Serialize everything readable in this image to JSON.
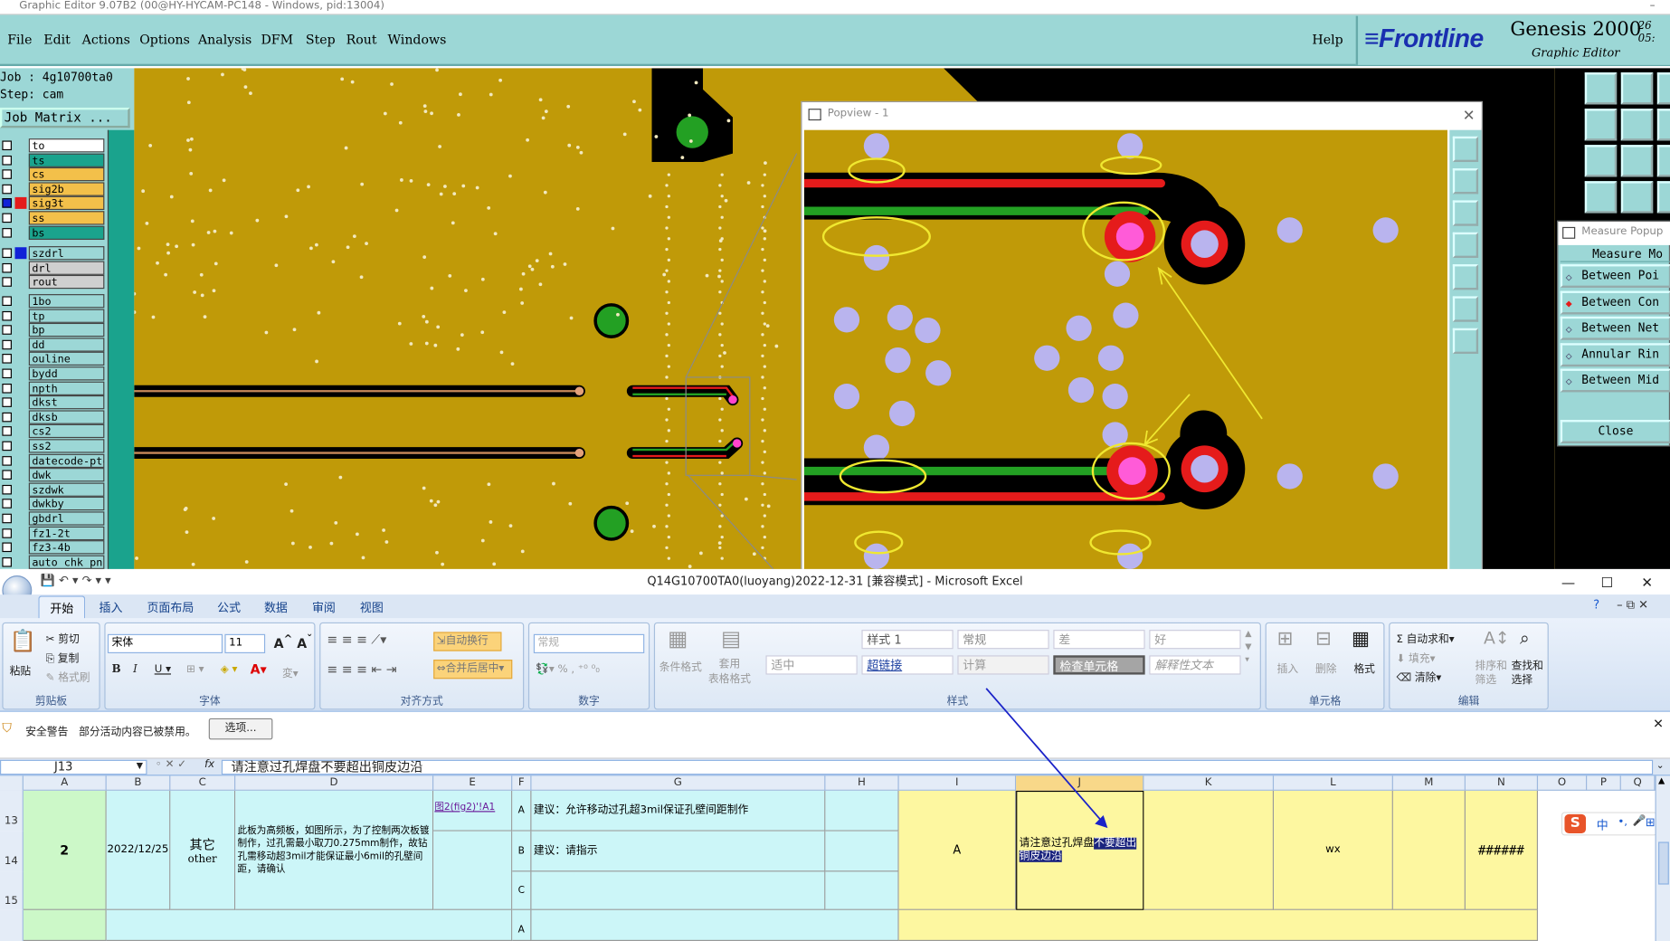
{
  "genesis": {
    "title_bar": "Graphic Editor 9.07B2 (00@HY-HYCAM-PC148 - Windows, pid:13004)",
    "menu": [
      "File",
      "Edit",
      "Actions",
      "Options",
      "Analysis",
      "DFM",
      "Step",
      "Rout",
      "Windows"
    ],
    "help": "Help",
    "brand": {
      "logo": "Frontline",
      "product": "Genesis 2000",
      "subtitle": "Graphic Editor",
      "time1": "26",
      "time2": "05:"
    },
    "job_label": "Job : 4g10700ta0",
    "step_label": "Step: cam",
    "job_matrix": "Job Matrix ...",
    "layers": [
      {
        "name": "to",
        "color": "#ffffff",
        "mark": ""
      },
      {
        "name": "ts",
        "color": "#1aa38d",
        "mark": ""
      },
      {
        "name": "cs",
        "color": "#f3c04a",
        "mark": ""
      },
      {
        "name": "sig2b",
        "color": "#f3c04a",
        "mark": ""
      },
      {
        "name": "sig3t",
        "color": "#f3c04a",
        "mark": "#e51b1b",
        "sel": true
      },
      {
        "name": "ss",
        "color": "#f3c04a",
        "mark": ""
      },
      {
        "name": "bs",
        "color": "#1aa38d",
        "mark": ""
      },
      {
        "name": "szdrl",
        "color": "#9cd7d6",
        "mark": "#1022d8"
      },
      {
        "name": "drl",
        "color": "#cfcfcf",
        "mark": ""
      },
      {
        "name": "rout",
        "color": "#cfcfcf",
        "mark": ""
      },
      {
        "name": "1bo",
        "color": "#9cd7d6",
        "mark": ""
      },
      {
        "name": "tp",
        "color": "#9cd7d6",
        "mark": ""
      },
      {
        "name": "bp",
        "color": "#9cd7d6",
        "mark": ""
      },
      {
        "name": "dd",
        "color": "#9cd7d6",
        "mark": ""
      },
      {
        "name": "ouline",
        "color": "#9cd7d6",
        "mark": ""
      },
      {
        "name": "bydd",
        "color": "#9cd7d6",
        "mark": ""
      },
      {
        "name": "npth",
        "color": "#9cd7d6",
        "mark": ""
      },
      {
        "name": "dkst",
        "color": "#9cd7d6",
        "mark": ""
      },
      {
        "name": "dksb",
        "color": "#9cd7d6",
        "mark": ""
      },
      {
        "name": "cs2",
        "color": "#9cd7d6",
        "mark": ""
      },
      {
        "name": "ss2",
        "color": "#9cd7d6",
        "mark": ""
      },
      {
        "name": "datecode-pte",
        "color": "#9cd7d6",
        "mark": ""
      },
      {
        "name": "dwk",
        "color": "#9cd7d6",
        "mark": ""
      },
      {
        "name": "szdwk",
        "color": "#9cd7d6",
        "mark": ""
      },
      {
        "name": "dwkby",
        "color": "#9cd7d6",
        "mark": ""
      },
      {
        "name": "gbdrl",
        "color": "#9cd7d6",
        "mark": ""
      },
      {
        "name": "fz1-2t",
        "color": "#9cd7d6",
        "mark": ""
      },
      {
        "name": "fz3-4b",
        "color": "#9cd7d6",
        "mark": ""
      },
      {
        "name": "auto_chk_pn",
        "color": "#9cd7d6",
        "mark": ""
      }
    ],
    "popview_title": "Popview - 1",
    "measure": {
      "title": "Measure Popup",
      "header": "Measure Mo",
      "options": [
        "Between Poi",
        "Between Con",
        "Between Net",
        "Annular Rin",
        "Between Mid"
      ],
      "selected": 1,
      "close": "Close"
    }
  },
  "excel": {
    "title": "Q14G10700TA0(luoyang)2022-12-31  [兼容模式] - Microsoft Excel",
    "tabs": [
      "开始",
      "插入",
      "页面布局",
      "公式",
      "数据",
      "审阅",
      "视图"
    ],
    "clipboard": {
      "paste": "粘贴",
      "cut": "剪切",
      "copy": "复制",
      "format_painter": "格式刷",
      "group": "剪贴板"
    },
    "font": {
      "name": "宋体",
      "size": "11",
      "group": "字体"
    },
    "align": {
      "wrap": "自动换行",
      "merge": "合并后居中",
      "group": "对齐方式"
    },
    "number": {
      "format": "常规",
      "group": "数字"
    },
    "styles": {
      "cond": "条件格式",
      "table": "套用\n表格格式",
      "group": "样式",
      "cells": [
        {
          "t": "适中",
          "c": "#999"
        },
        {
          "t": "样式 1",
          "c": "#555"
        },
        {
          "t": "超链接",
          "c": "#1a3ea0",
          "u": true
        },
        {
          "t": "常规",
          "c": "#888"
        },
        {
          "t": "计算",
          "c": "#999"
        },
        {
          "t": "差",
          "c": "#999"
        },
        {
          "t": "检查单元格",
          "c": "#fff"
        },
        {
          "t": "好",
          "c": "#999"
        },
        {
          "t": "解释性文本",
          "c": "#999",
          "i": true
        }
      ]
    },
    "cells_group": {
      "insert": "插入",
      "delete": "删除",
      "format": "格式",
      "group": "单元格"
    },
    "edit": {
      "autosum": "自动求和",
      "fill": "填充",
      "clear": "清除",
      "sort": "排序和\n筛选",
      "find": "查找和\n选择",
      "group": "编辑"
    },
    "security": {
      "label": "安全警告",
      "message": "部分活动内容已被禁用。",
      "button": "选项..."
    },
    "formula": {
      "namebox": "J13",
      "fx": "fx",
      "content": "请注意过孔焊盘不要超出铜皮边沿"
    },
    "columns": [
      "A",
      "B",
      "C",
      "D",
      "E",
      "F",
      "G",
      "H",
      "I",
      "J",
      "K",
      "L",
      "M",
      "N",
      "O",
      "P",
      "Q"
    ],
    "rows": [
      "13",
      "14",
      "15"
    ],
    "data": {
      "a": "2",
      "b": "2022/12/25",
      "c1": "其它",
      "c2": "other",
      "d": "此板为高频板，如图所示，为了控制两次板镀制作，过孔需最小取刀0.275mm制作，故钻孔需移动超3mil才能保证最小6mil的孔壁间距，请确认",
      "e": "图2(fig2)'!A1",
      "f": [
        "A",
        "B",
        "C",
        "A"
      ],
      "g": [
        "建议：允许移动过孔超3mil保证孔壁间距制作",
        "建议：请指示",
        ""
      ],
      "i": "A",
      "j_plain": "请注意过孔焊盘",
      "j_sel1": "不要超出",
      "j_sel2": "铜皮边沿",
      "l": "wx",
      "n": "######"
    },
    "ime": [
      "中",
      "•,",
      "🎤",
      "⊞"
    ]
  }
}
